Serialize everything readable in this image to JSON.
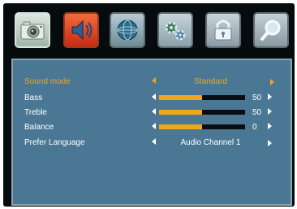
{
  "tabs": [
    {
      "icon": "camera-icon",
      "selected": false
    },
    {
      "icon": "speaker-icon",
      "selected": true
    },
    {
      "icon": "globe-icon",
      "selected": false
    },
    {
      "icon": "gears-icon",
      "selected": false
    },
    {
      "icon": "lock-icon",
      "selected": false
    },
    {
      "icon": "magnifier-icon",
      "selected": false
    }
  ],
  "menu": {
    "sound_mode": {
      "label": "Sound mode",
      "value": "Standard"
    },
    "bass": {
      "label": "Bass",
      "value": "50",
      "level": 0.5
    },
    "treble": {
      "label": "Treble",
      "value": "50",
      "level": 0.5
    },
    "balance": {
      "label": "Balance",
      "value": "0",
      "level": 0.5
    },
    "prefer_language": {
      "label": "Prefer Language",
      "value": "Audio Channel 1"
    }
  },
  "colors": {
    "panel": "#4a7894",
    "highlight": "#f2a31c",
    "bar_fill": "#f0a81b",
    "bar_track": "#0b0d0e",
    "background": "#060b0d"
  }
}
